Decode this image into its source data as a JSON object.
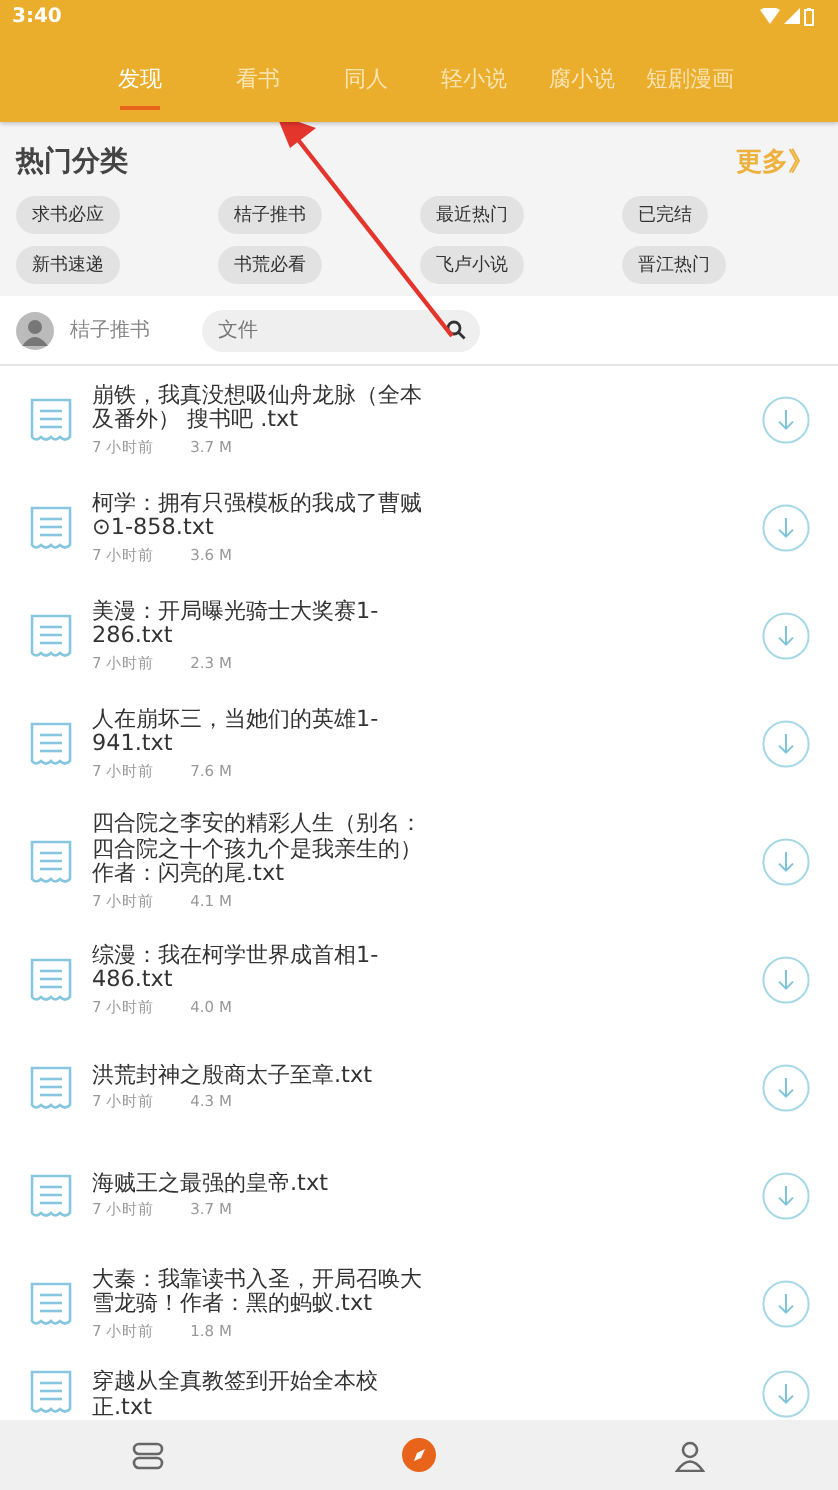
{
  "status_bar": {
    "time": "3:40"
  },
  "tabs": [
    {
      "label": "发现",
      "selected": true
    },
    {
      "label": "看书",
      "selected": false
    },
    {
      "label": "同人",
      "selected": false
    },
    {
      "label": "轻小说",
      "selected": false
    },
    {
      "label": "腐小说",
      "selected": false
    },
    {
      "label": "短剧漫画",
      "selected": false
    }
  ],
  "hot_categories": {
    "title": "热门分类",
    "more": "更多》",
    "tags": [
      "求书必应",
      "桔子推书",
      "最近热门",
      "已完结",
      "新书速递",
      "书荒必看",
      "飞卢小说",
      "晋江热门"
    ]
  },
  "filter": {
    "user": "桔子推书",
    "search": {
      "placeholder": "文件"
    }
  },
  "files": [
    {
      "title": "崩铁，我真没想吸仙舟龙脉（全本及番外） 搜书吧 .txt",
      "time": "7 小时前",
      "size": "3.7 M"
    },
    {
      "title": "柯学：拥有只强模板的我成了曹贼⊙1-858.txt",
      "time": "7 小时前",
      "size": "3.6 M"
    },
    {
      "title": "美漫：开局曝光骑士大奖赛1-286.txt",
      "time": "7 小时前",
      "size": "2.3 M"
    },
    {
      "title": "人在崩坏三，当她们的英雄1-941.txt",
      "time": "7 小时前",
      "size": "7.6 M"
    },
    {
      "title": "四合院之李安的精彩人生（别名：四合院之十个孩九个是我亲生的）作者：闪亮的尾.txt",
      "time": "7 小时前",
      "size": "4.1 M"
    },
    {
      "title": "综漫：我在柯学世界成首相1-486.txt",
      "time": "7 小时前",
      "size": "4.0 M"
    },
    {
      "title": "洪荒封神之殷商太子至章.txt",
      "time": "7 小时前",
      "size": "4.3 M"
    },
    {
      "title": "海贼王之最强的皇帝.txt",
      "time": "7 小时前",
      "size": "3.7 M"
    },
    {
      "title": "大秦：我靠读书入圣，开局召唤大雪龙骑！作者：黑的蚂蚁.txt",
      "time": "7 小时前",
      "size": "1.8 M"
    },
    {
      "title": "穿越从全真教签到开始全本校正.txt"
    }
  ],
  "bottom_nav": [
    {
      "kind": "bookshelf",
      "selected": false
    },
    {
      "kind": "compass",
      "selected": true
    },
    {
      "kind": "profile",
      "selected": false
    }
  ]
}
